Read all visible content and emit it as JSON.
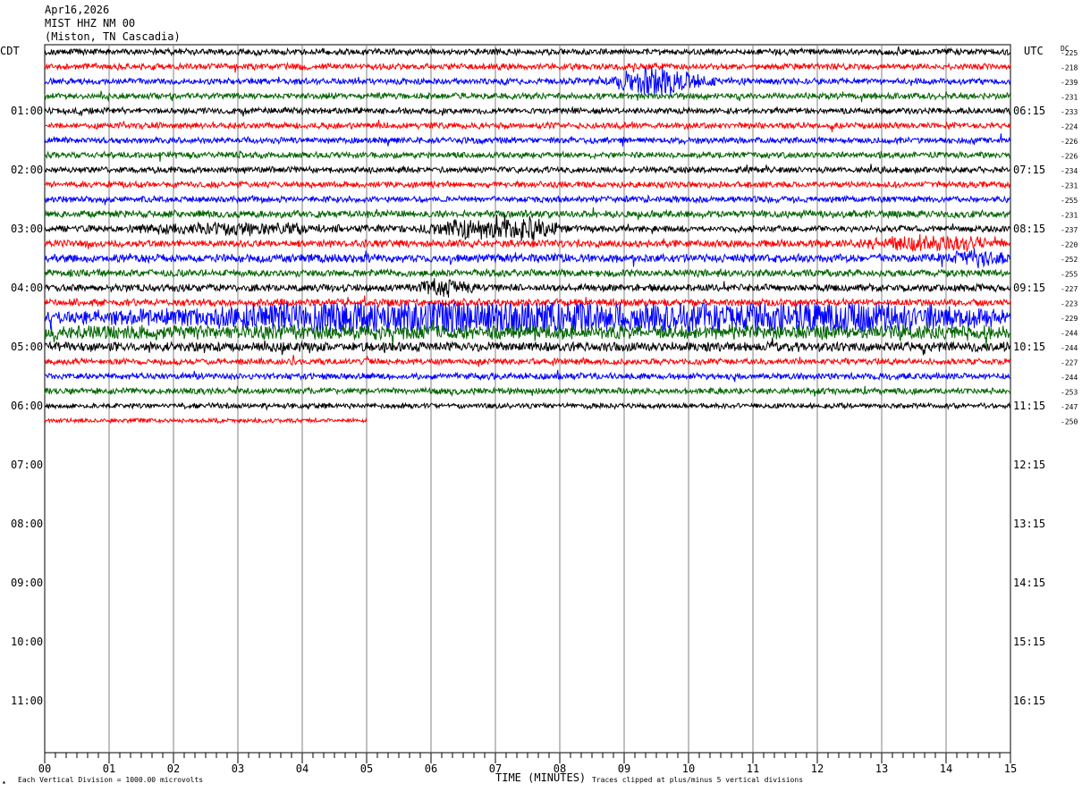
{
  "header": {
    "date": "Apr16,2026",
    "station": "MIST HHZ NM 00",
    "location": "(Miston, TN Cascadia)"
  },
  "left_timezone": "CDT",
  "right_timezone": "UTC",
  "dc_label": "DC",
  "footer": {
    "left_note": "Each Vertical Division = 1000.00 microvolts",
    "x_title": "TIME (MINUTES)",
    "right_note": "Traces clipped at plus/minus 5 vertical divisions"
  },
  "chart_data": {
    "type": "line",
    "title": "",
    "xlabel": "TIME (MINUTES)",
    "x_ticks": [
      "00",
      "01",
      "02",
      "03",
      "04",
      "05",
      "06",
      "07",
      "08",
      "09",
      "10",
      "11",
      "12",
      "13",
      "14",
      "15"
    ],
    "xlim": [
      0,
      15
    ],
    "grid": true,
    "left_hour_labels": [
      "01:00",
      "02:00",
      "03:00",
      "04:00",
      "05:00",
      "06:00",
      "07:00",
      "08:00",
      "09:00",
      "10:00",
      "11:00"
    ],
    "right_hour_labels": [
      "06:15",
      "07:15",
      "08:15",
      "09:15",
      "10:15",
      "11:15",
      "12:15",
      "13:15",
      "14:15",
      "15:15",
      "16:15"
    ],
    "trace_colors": [
      "#000000",
      "#ff0000",
      "#0000ff",
      "#006400"
    ],
    "traces": [
      {
        "row": 0,
        "dc": "-225",
        "amp": 3,
        "end": 15
      },
      {
        "row": 1,
        "dc": "-218",
        "amp": 3,
        "end": 15
      },
      {
        "row": 2,
        "dc": "-239",
        "amp": 3,
        "end": 15,
        "events": [
          [
            9.5,
            14,
            0.6
          ]
        ]
      },
      {
        "row": 3,
        "dc": "-231",
        "amp": 3,
        "end": 15
      },
      {
        "row": 4,
        "dc": "-233",
        "amp": 3,
        "end": 15
      },
      {
        "row": 5,
        "dc": "-224",
        "amp": 3,
        "end": 15
      },
      {
        "row": 6,
        "dc": "-226",
        "amp": 3,
        "end": 15
      },
      {
        "row": 7,
        "dc": "-226",
        "amp": 3,
        "end": 15
      },
      {
        "row": 8,
        "dc": "-234",
        "amp": 3,
        "end": 15
      },
      {
        "row": 9,
        "dc": "-231",
        "amp": 3,
        "end": 15
      },
      {
        "row": 10,
        "dc": "-255",
        "amp": 3,
        "end": 15
      },
      {
        "row": 11,
        "dc": "-231",
        "amp": 3.5,
        "end": 15
      },
      {
        "row": 12,
        "dc": "-237",
        "amp": 3,
        "end": 15,
        "events": [
          [
            6.6,
            7,
            0.6
          ],
          [
            7.55,
            9,
            0.4
          ],
          [
            3.0,
            4,
            1.4
          ]
        ]
      },
      {
        "row": 13,
        "dc": "-220",
        "amp": 3.5,
        "end": 15,
        "events": [
          [
            13.8,
            5,
            1.0
          ]
        ]
      },
      {
        "row": 14,
        "dc": "-252",
        "amp": 4,
        "end": 15,
        "events": [
          [
            14.5,
            6,
            0.4
          ]
        ]
      },
      {
        "row": 15,
        "dc": "-255",
        "amp": 3.5,
        "end": 15
      },
      {
        "row": 16,
        "dc": "-227",
        "amp": 3.5,
        "end": 15,
        "events": [
          [
            6.2,
            6,
            0.4
          ]
        ]
      },
      {
        "row": 17,
        "dc": "-223",
        "amp": 3.5,
        "end": 15
      },
      {
        "row": 18,
        "dc": "-229",
        "amp": 5,
        "end": 15,
        "events": [
          [
            7.5,
            9,
            5.0
          ],
          [
            12.2,
            8,
            2.5
          ],
          [
            5.5,
            7,
            3.0
          ]
        ]
      },
      {
        "row": 19,
        "dc": "-244",
        "amp": 7,
        "end": 15
      },
      {
        "row": 20,
        "dc": "-244",
        "amp": 4.5,
        "end": 15
      },
      {
        "row": 21,
        "dc": "-227",
        "amp": 3,
        "end": 15
      },
      {
        "row": 22,
        "dc": "-244",
        "amp": 3,
        "end": 15
      },
      {
        "row": 23,
        "dc": "-253",
        "amp": 3,
        "end": 15
      },
      {
        "row": 24,
        "dc": "-247",
        "amp": 2.5,
        "end": 15
      },
      {
        "row": 25,
        "dc": "-250",
        "amp": 2,
        "end": 5
      }
    ]
  }
}
